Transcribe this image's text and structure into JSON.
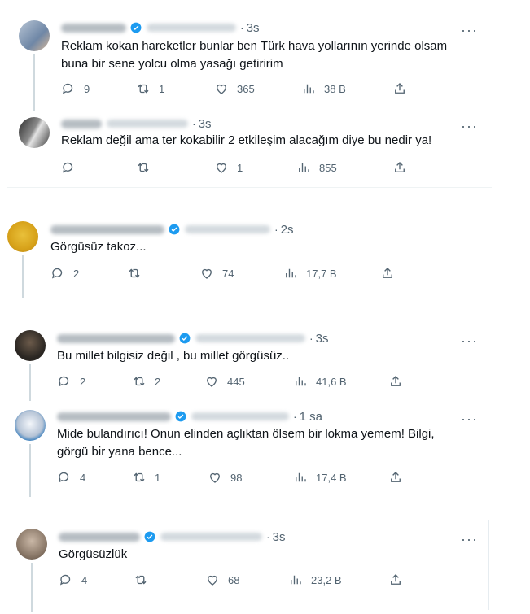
{
  "more_label": "···",
  "tweets": [
    {
      "time": "3s",
      "text": "Reklam kokan hareketler bunlar ben Türk hava yollarının yerinde olsam buna bir sene yolcu olma yasağı getiririm",
      "replies": "9",
      "retweets": "1",
      "likes": "365",
      "views": "38 B"
    },
    {
      "time": "3s",
      "text": "Reklam değil ama ter kokabilir 2 etkileşim alacağım diye bu nedir ya!",
      "replies": "",
      "retweets": "",
      "likes": "1",
      "views": "855"
    },
    {
      "time": "2s",
      "text": "Görgüsüz takoz...",
      "replies": "2",
      "retweets": "",
      "likes": "74",
      "views": "17,7 B"
    },
    {
      "time": "3s",
      "text": "Bu millet bilgisiz değil ,  bu millet görgüsüz..",
      "replies": "2",
      "retweets": "2",
      "likes": "445",
      "views": "41,6 B"
    },
    {
      "time": "1 sa",
      "text": "Mide bulandırıcı! Onun elinden açlıktan ölsem bir lokma yemem! Bilgi, görgü bir yana bence...",
      "replies": "4",
      "retweets": "1",
      "likes": "98",
      "views": "17,4 B"
    },
    {
      "time": "3s",
      "text": "Görgüsüzlük",
      "replies": "4",
      "retweets": "",
      "likes": "68",
      "views": "23,2 B"
    }
  ],
  "colors": {
    "verified": "#1d9bf0",
    "icon": "#536471",
    "text": "#0f1419"
  },
  "icons": [
    "reply-icon",
    "retweet-icon",
    "like-icon",
    "views-icon",
    "share-icon",
    "verified-icon",
    "more-icon"
  ]
}
